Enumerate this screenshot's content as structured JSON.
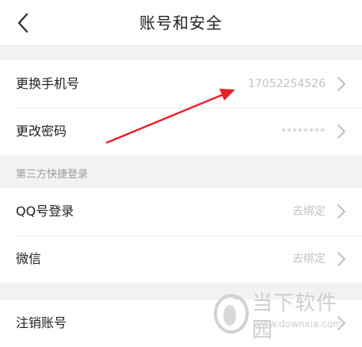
{
  "header": {
    "title": "账号和安全",
    "back_icon": "chevron-left-icon"
  },
  "account": {
    "rows": [
      {
        "label": "更换手机号",
        "value": "17052254526"
      },
      {
        "label": "更改密码",
        "value": "********"
      }
    ]
  },
  "third_party": {
    "section_title": "第三方快捷登录",
    "rows": [
      {
        "label": "QQ号登录",
        "value": "去绑定"
      },
      {
        "label": "微信",
        "value": "去绑定"
      }
    ]
  },
  "danger": {
    "rows": [
      {
        "label": "注销账号"
      }
    ]
  },
  "annotation": {
    "arrow_color": "#e8202a"
  },
  "watermark": {
    "name": "当下软件园",
    "url": "www.downxia.com"
  },
  "colors": {
    "background": "#f2f2f2",
    "card": "#ffffff",
    "text_primary": "#222222",
    "text_secondary": "#c3c3c3",
    "section_label": "#9a9a9a"
  }
}
